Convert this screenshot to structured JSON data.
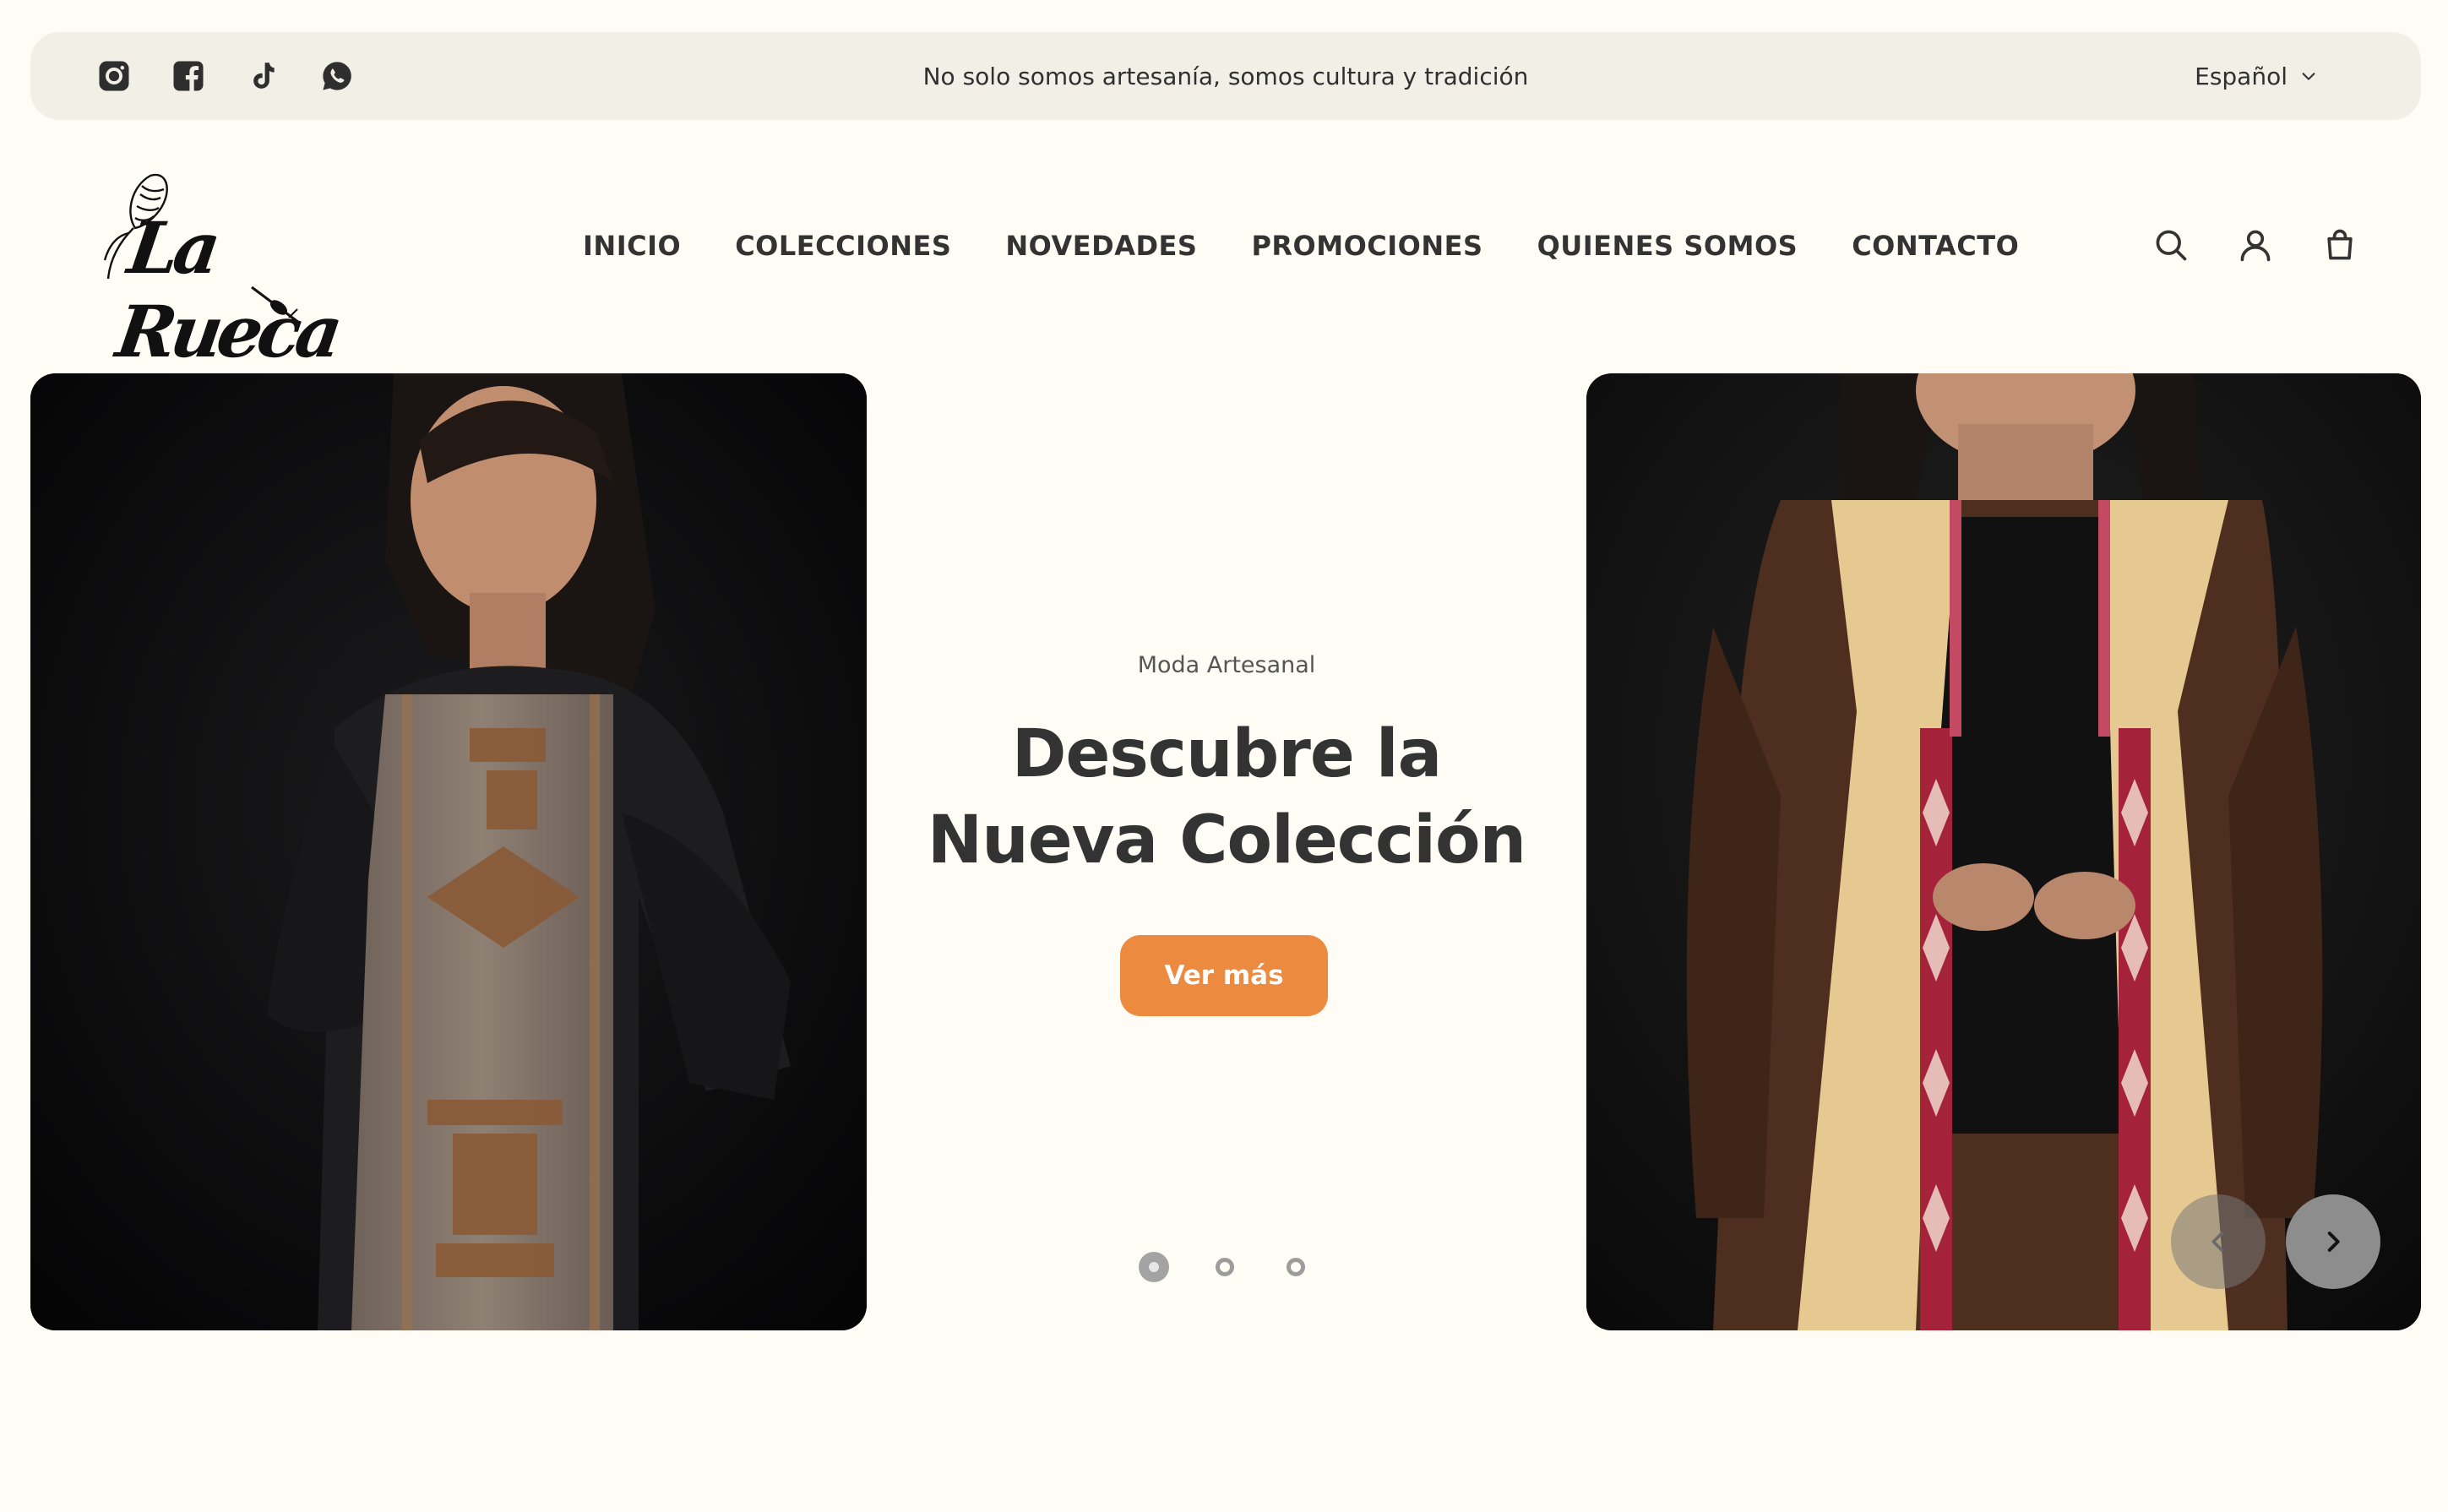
{
  "social": {
    "icons": [
      "instagram-icon",
      "facebook-icon",
      "tiktok-icon",
      "whatsapp-icon"
    ]
  },
  "announcement": {
    "text": "No solo somos artesanía, somos cultura y tradición"
  },
  "language": {
    "selected": "Español"
  },
  "logo": {
    "text": "La Rueca"
  },
  "nav": {
    "items": [
      {
        "label": "INICIO"
      },
      {
        "label": "COLECCIONES"
      },
      {
        "label": "NOVEDADES"
      },
      {
        "label": "PROMOCIONES"
      },
      {
        "label": "QUIENES SOMOS"
      },
      {
        "label": "CONTACTO"
      }
    ]
  },
  "header_icons": [
    "search-icon",
    "account-icon",
    "cart-icon"
  ],
  "hero": {
    "eyebrow": "Moda Artesanal",
    "title_line1": "Descubre la",
    "title_line2": "Nueva Colección",
    "cta_label": "Ver más",
    "slide_count": 3,
    "active_slide": 1
  },
  "colors": {
    "page_bg": "#fefcf4",
    "topbar_bg": "#f1efe6",
    "accent": "#ec8a3f",
    "text": "#333333"
  }
}
